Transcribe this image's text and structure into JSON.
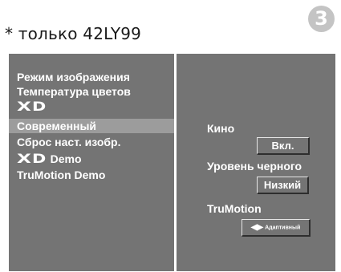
{
  "note": "* только 42LY99",
  "step_badge": "3",
  "menu": {
    "items": [
      {
        "label": "Режим изображения",
        "selected": false
      },
      {
        "label": "Температура цветов",
        "selected": false
      },
      {
        "label": "XD",
        "selected": false
      },
      {
        "label": "Современный",
        "selected": true
      },
      {
        "label": "Сброс наст. изобр.",
        "selected": false
      },
      {
        "label": "XD Demo",
        "logo": "XD",
        "suffix": "Demo",
        "selected": false
      },
      {
        "label": "TruMotion Demo",
        "selected": false
      }
    ]
  },
  "options": {
    "kino": {
      "label": "Кино",
      "value": "Вкл."
    },
    "black_level": {
      "label": "Уровень черного",
      "value": "Низкий"
    },
    "trumotion": {
      "label": "TruMotion",
      "value": "Адаптивный"
    }
  },
  "colors": {
    "osd_background": "#747474",
    "selected_row": "#9c9c9c",
    "divider": "#ffffff",
    "badge": "#c4c4c4"
  }
}
